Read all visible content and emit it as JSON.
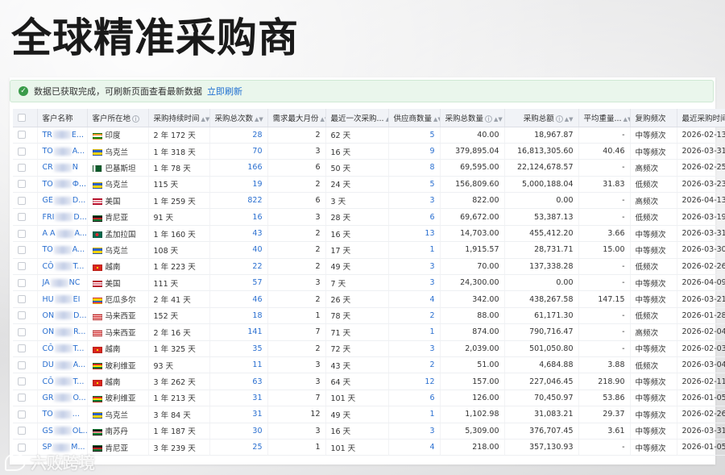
{
  "headline": "全球精准采购商",
  "alert": {
    "message": "数据已获取完成，可刷新页面查看最新数据",
    "action": "立即刷新"
  },
  "columns": [
    {
      "key": "name",
      "label": "客户名称"
    },
    {
      "key": "country",
      "label": "客户所在地"
    },
    {
      "key": "duration",
      "label": "采购持续时间"
    },
    {
      "key": "times",
      "label": "采购总次数"
    },
    {
      "key": "maxMonth",
      "label": "需求最大月份"
    },
    {
      "key": "lastBuy",
      "label": "最近一次采购..."
    },
    {
      "key": "suppliers",
      "label": "供应商数量"
    },
    {
      "key": "qty",
      "label": "采购总数量"
    },
    {
      "key": "amount",
      "label": "采购总额"
    },
    {
      "key": "avgWeight",
      "label": "平均重量..."
    },
    {
      "key": "freq",
      "label": "复购频次"
    },
    {
      "key": "recent",
      "label": "最近采购时间"
    }
  ],
  "rows": [
    {
      "name_a": "TR",
      "name_b": "E...",
      "flag": "india",
      "country": "印度",
      "duration": "2 年 172 天",
      "times": "28",
      "maxMonth": "2",
      "lastBuy": "62 天",
      "suppliers": "5",
      "qty": "40.00",
      "amount": "18,967.87",
      "avgWeight": "-",
      "freq": "中等频次",
      "recent": "2026-02-13"
    },
    {
      "name_a": "TO",
      "name_b": "A...",
      "flag": "ukraine",
      "country": "乌克兰",
      "duration": "1 年 318 天",
      "times": "70",
      "maxMonth": "3",
      "lastBuy": "16 天",
      "suppliers": "9",
      "qty": "379,895.04",
      "amount": "16,813,305.60",
      "avgWeight": "40.46",
      "freq": "中等频次",
      "recent": "2026-03-31"
    },
    {
      "name_a": "CR",
      "name_b": "N",
      "flag": "pakistan",
      "country": "巴基斯坦",
      "duration": "1 年 78 天",
      "times": "166",
      "maxMonth": "6",
      "lastBuy": "50 天",
      "suppliers": "8",
      "qty": "69,595.00",
      "amount": "22,124,678.57",
      "avgWeight": "-",
      "freq": "高频次",
      "recent": "2026-02-25"
    },
    {
      "name_a": "TO",
      "name_b": "Ф...",
      "flag": "ukraine",
      "country": "乌克兰",
      "duration": "115 天",
      "times": "19",
      "maxMonth": "2",
      "lastBuy": "24 天",
      "suppliers": "5",
      "qty": "156,809.60",
      "amount": "5,000,188.04",
      "avgWeight": "31.83",
      "freq": "低频次",
      "recent": "2026-03-23"
    },
    {
      "name_a": "GE",
      "name_b": "D...",
      "flag": "usa",
      "country": "美国",
      "duration": "1 年 259 天",
      "times": "822",
      "maxMonth": "6",
      "lastBuy": "3 天",
      "suppliers": "3",
      "qty": "822.00",
      "amount": "0.00",
      "avgWeight": "-",
      "freq": "高频次",
      "recent": "2026-04-13"
    },
    {
      "name_a": "FRI",
      "name_b": "D...",
      "flag": "kenya",
      "country": "肯尼亚",
      "duration": "91 天",
      "times": "16",
      "maxMonth": "3",
      "lastBuy": "28 天",
      "suppliers": "6",
      "qty": "69,672.00",
      "amount": "53,387.13",
      "avgWeight": "-",
      "freq": "低频次",
      "recent": "2026-03-19"
    },
    {
      "name_a": "A A",
      "name_b": "A...",
      "flag": "bangladesh",
      "country": "孟加拉国",
      "duration": "1 年 160 天",
      "times": "43",
      "maxMonth": "2",
      "lastBuy": "16 天",
      "suppliers": "13",
      "qty": "14,703.00",
      "amount": "455,412.20",
      "avgWeight": "3.66",
      "freq": "中等频次",
      "recent": "2026-03-31"
    },
    {
      "name_a": "TO",
      "name_b": "A...",
      "flag": "ukraine",
      "country": "乌克兰",
      "duration": "108 天",
      "times": "40",
      "maxMonth": "2",
      "lastBuy": "17 天",
      "suppliers": "1",
      "qty": "1,915.57",
      "amount": "28,731.71",
      "avgWeight": "15.00",
      "freq": "中等频次",
      "recent": "2026-03-30"
    },
    {
      "name_a": "CÔ",
      "name_b": "T...",
      "flag": "vietnam",
      "country": "越南",
      "duration": "1 年 223 天",
      "times": "22",
      "maxMonth": "2",
      "lastBuy": "49 天",
      "suppliers": "3",
      "qty": "70.00",
      "amount": "137,338.28",
      "avgWeight": "-",
      "freq": "低频次",
      "recent": "2026-02-26"
    },
    {
      "name_a": "JA",
      "name_b": "NC",
      "flag": "usa",
      "country": "美国",
      "duration": "111 天",
      "times": "57",
      "maxMonth": "3",
      "lastBuy": "7 天",
      "suppliers": "3",
      "qty": "24,300.00",
      "amount": "0.00",
      "avgWeight": "-",
      "freq": "中等频次",
      "recent": "2026-04-09"
    },
    {
      "name_a": "HU",
      "name_b": "EI",
      "flag": "ecuador",
      "country": "厄瓜多尔",
      "duration": "2 年 41 天",
      "times": "46",
      "maxMonth": "2",
      "lastBuy": "26 天",
      "suppliers": "4",
      "qty": "342.00",
      "amount": "438,267.58",
      "avgWeight": "147.15",
      "freq": "中等频次",
      "recent": "2026-03-21"
    },
    {
      "name_a": "ON",
      "name_b": "D...",
      "flag": "malaysia",
      "country": "马来西亚",
      "duration": "152 天",
      "times": "18",
      "maxMonth": "1",
      "lastBuy": "78 天",
      "suppliers": "2",
      "qty": "88.00",
      "amount": "61,171.30",
      "avgWeight": "-",
      "freq": "低频次",
      "recent": "2026-01-28"
    },
    {
      "name_a": "ON",
      "name_b": "R...",
      "flag": "malaysia",
      "country": "马来西亚",
      "duration": "2 年 16 天",
      "times": "141",
      "maxMonth": "7",
      "lastBuy": "71 天",
      "suppliers": "1",
      "qty": "874.00",
      "amount": "790,716.47",
      "avgWeight": "-",
      "freq": "高频次",
      "recent": "2026-02-04"
    },
    {
      "name_a": "CÔ",
      "name_b": "T...",
      "flag": "vietnam",
      "country": "越南",
      "duration": "1 年 325 天",
      "times": "35",
      "maxMonth": "2",
      "lastBuy": "72 天",
      "suppliers": "3",
      "qty": "2,039.00",
      "amount": "501,050.80",
      "avgWeight": "-",
      "freq": "中等频次",
      "recent": "2026-02-03"
    },
    {
      "name_a": "DU",
      "name_b": "A...",
      "flag": "bolivia",
      "country": "玻利维亚",
      "duration": "93 天",
      "times": "11",
      "maxMonth": "3",
      "lastBuy": "43 天",
      "suppliers": "2",
      "qty": "51.00",
      "amount": "4,684.88",
      "avgWeight": "3.88",
      "freq": "低频次",
      "recent": "2026-03-04"
    },
    {
      "name_a": "CÔ",
      "name_b": "T...",
      "flag": "vietnam",
      "country": "越南",
      "duration": "3 年 262 天",
      "times": "63",
      "maxMonth": "3",
      "lastBuy": "64 天",
      "suppliers": "12",
      "qty": "157.00",
      "amount": "227,046.45",
      "avgWeight": "218.90",
      "freq": "中等频次",
      "recent": "2026-02-11"
    },
    {
      "name_a": "GR",
      "name_b": "O...",
      "flag": "bolivia",
      "country": "玻利维亚",
      "duration": "1 年 213 天",
      "times": "31",
      "maxMonth": "7",
      "lastBuy": "101 天",
      "suppliers": "6",
      "qty": "126.00",
      "amount": "70,450.97",
      "avgWeight": "53.86",
      "freq": "中等频次",
      "recent": "2026-01-05"
    },
    {
      "name_a": "TO",
      "name_b": "...",
      "flag": "ukraine",
      "country": "乌克兰",
      "duration": "3 年 84 天",
      "times": "31",
      "maxMonth": "12",
      "lastBuy": "49 天",
      "suppliers": "1",
      "qty": "1,102.98",
      "amount": "31,083.21",
      "avgWeight": "29.37",
      "freq": "中等频次",
      "recent": "2026-02-26"
    },
    {
      "name_a": "GS",
      "name_b": "OL...",
      "flag": "southsudan",
      "country": "南苏丹",
      "duration": "1 年 187 天",
      "times": "30",
      "maxMonth": "3",
      "lastBuy": "16 天",
      "suppliers": "3",
      "qty": "5,309.00",
      "amount": "376,707.45",
      "avgWeight": "3.61",
      "freq": "中等频次",
      "recent": "2026-03-31"
    },
    {
      "name_a": "SP",
      "name_b": "M...",
      "flag": "kenya",
      "country": "肯尼亚",
      "duration": "3 年 239 天",
      "times": "25",
      "maxMonth": "1",
      "lastBuy": "101 天",
      "suppliers": "4",
      "qty": "218.00",
      "amount": "357,130.93",
      "avgWeight": "-",
      "freq": "中等频次",
      "recent": "2026-01-05"
    }
  ],
  "watermark": "六败跨境",
  "colors": {
    "link": "#2a6fd0",
    "success": "#3a9b4a",
    "header_bg": "#f1f3f7"
  }
}
